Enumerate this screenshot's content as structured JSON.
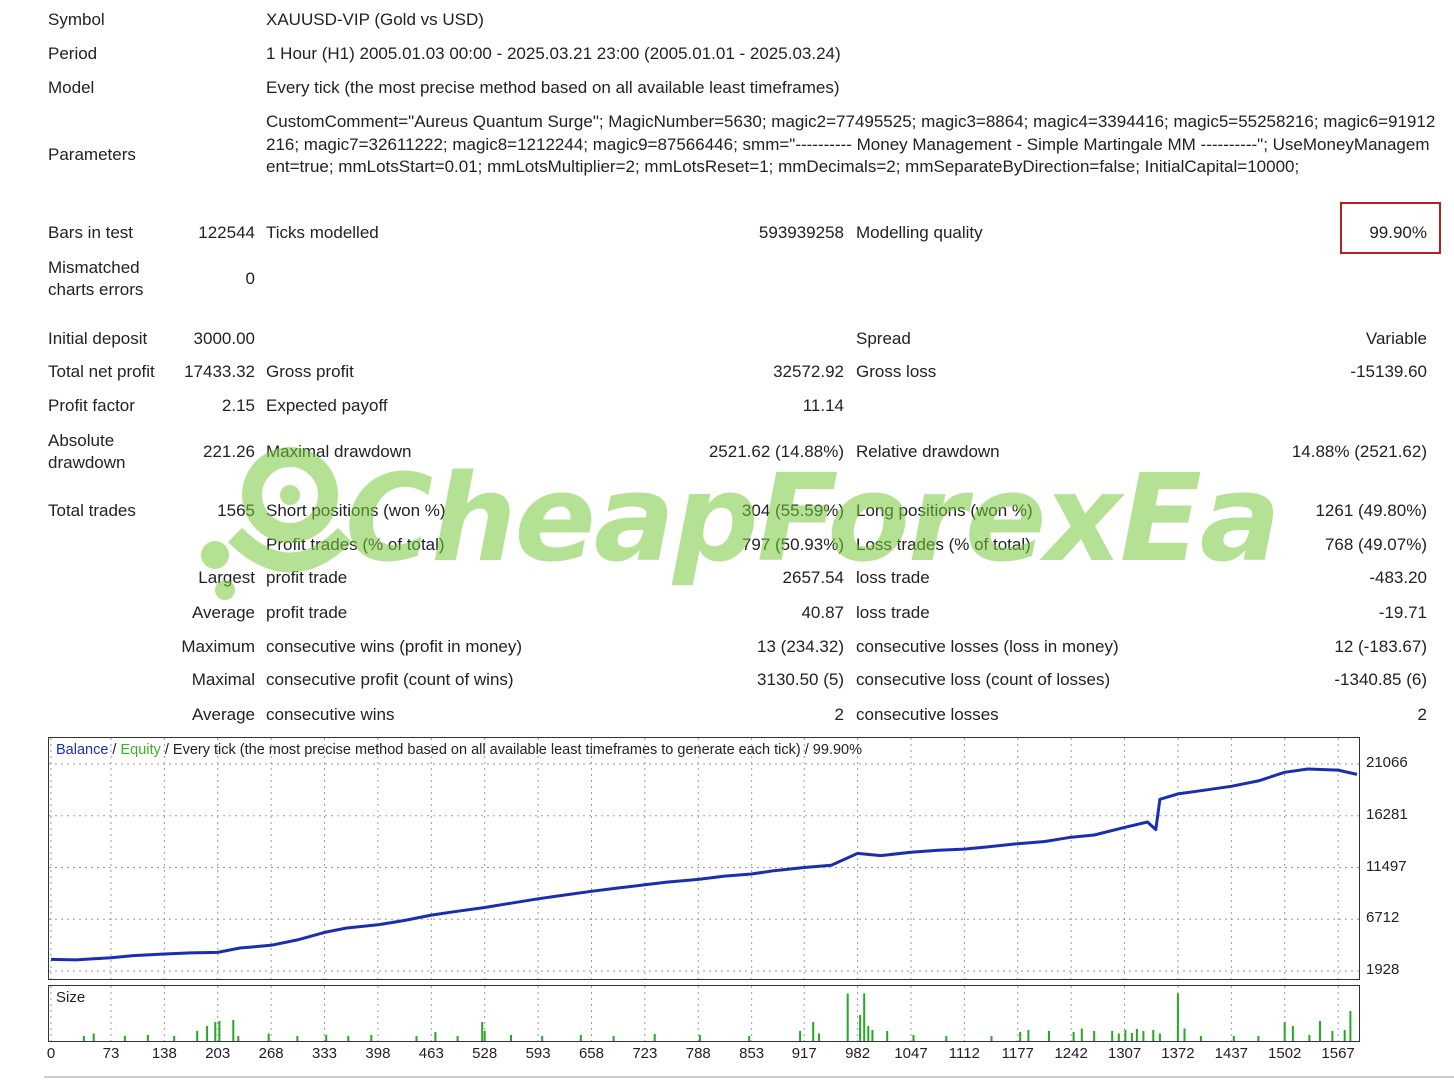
{
  "report": {
    "symbol_label": "Symbol",
    "symbol_value": "XAUUSD-VIP (Gold vs USD)",
    "period_label": "Period",
    "period_value": "1 Hour (H1) 2005.01.03 00:00 - 2025.03.21 23:00 (2005.01.01 - 2025.03.24)",
    "model_label": "Model",
    "model_value": "Every tick (the most precise method based on all available least timeframes)",
    "parameters_label": "Parameters",
    "parameters_value": "CustomComment=\"Aureus Quantum Surge\"; MagicNumber=5630; magic2=77495525; magic3=8864; magic4=3394416; magic5=55258216; magic6=91912216; magic7=32611222; magic8=1212244; magic9=87566446; smm=\"---------- Money Management - Simple Martingale MM ----------\"; UseMoneyManagement=true; mmLotsStart=0.01; mmLotsMultiplier=2; mmLotsReset=1; mmDecimals=2; mmSeparateByDirection=false; InitialCapital=10000;",
    "bars_label": "Bars in test",
    "bars_value": "122544",
    "ticks_label": "Ticks modelled",
    "ticks_value": "593939258",
    "quality_label": "Modelling quality",
    "quality_value": "99.90%",
    "mismatched_label_1": "Mismatched",
    "mismatched_label_2": "charts errors",
    "mismatched_value": "0",
    "initial_deposit_label": "Initial deposit",
    "initial_deposit_value": "3000.00",
    "spread_label": "Spread",
    "spread_value": "Variable",
    "net_profit_label": "Total net profit",
    "net_profit_value": "17433.32",
    "gross_profit_label": "Gross profit",
    "gross_profit_value": "32572.92",
    "gross_loss_label": "Gross loss",
    "gross_loss_value": "-15139.60",
    "profit_factor_label": "Profit factor",
    "profit_factor_value": "2.15",
    "expected_payoff_label": "Expected payoff",
    "expected_payoff_value": "11.14",
    "abs_drawdown_label_1": "Absolute",
    "abs_drawdown_label_2": "drawdown",
    "abs_drawdown_value": "221.26",
    "max_drawdown_label": "Maximal drawdown",
    "max_drawdown_value": "2521.62 (14.88%)",
    "rel_drawdown_label": "Relative drawdown",
    "rel_drawdown_value": "14.88% (2521.62)",
    "total_trades_label": "Total trades",
    "total_trades_value": "1565",
    "short_label": "Short positions (won %)",
    "short_value": "304 (55.59%)",
    "long_label": "Long positions (won %)",
    "long_value": "1261 (49.80%)",
    "profit_trades_label": "Profit trades (% of total)",
    "profit_trades_value": "797 (50.93%)",
    "loss_trades_label": "Loss trades (% of total)",
    "loss_trades_value": "768 (49.07%)",
    "largest_label": "Largest",
    "largest_profit_label": "profit trade",
    "largest_profit_value": "2657.54",
    "largest_loss_label": "loss trade",
    "largest_loss_value": "-483.20",
    "average_label": "Average",
    "average_profit_label": "profit trade",
    "average_profit_value": "40.87",
    "average_loss_label": "loss trade",
    "average_loss_value": "-19.71",
    "maximum_label": "Maximum",
    "max_cons_wins_label": "consecutive wins (profit in money)",
    "max_cons_wins_value": "13 (234.32)",
    "max_cons_losses_label": "consecutive losses (loss in money)",
    "max_cons_losses_value": "12 (-183.67)",
    "maximal_label": "Maximal",
    "maximal_cons_profit_label": "consecutive profit (count of wins)",
    "maximal_cons_profit_value": "3130.50 (5)",
    "maximal_cons_loss_label": "consecutive loss (count of losses)",
    "maximal_cons_loss_value": "-1340.85 (6)",
    "average2_label": "Average",
    "avg_cons_wins_label": "consecutive wins",
    "avg_cons_wins_value": "2",
    "avg_cons_losses_label": "consecutive losses",
    "avg_cons_losses_value": "2"
  },
  "watermark": {
    "text": "CheapForexEa"
  },
  "chart": {
    "legend_balance": "Balance",
    "legend_sep1": " / ",
    "legend_equity": "Equity",
    "legend_rest": " / Every tick (the most precise method based on all available least timeframes to generate each tick) / 99.90%",
    "size_label": "Size",
    "colors": {
      "balance": "#1a2fb0",
      "equity": "#3fae2a",
      "volume": "#22aa22",
      "grid": "#9a9a9a"
    }
  },
  "chart_data": {
    "type": "line",
    "title": "",
    "series": [
      {
        "name": "Balance",
        "x": [
          0,
          30,
          73,
          100,
          138,
          170,
          203,
          230,
          268,
          300,
          333,
          360,
          398,
          430,
          463,
          490,
          528,
          560,
          593,
          620,
          658,
          690,
          723,
          750,
          788,
          820,
          853,
          880,
          917,
          950,
          982,
          1010,
          1047,
          1080,
          1112,
          1140,
          1177,
          1210,
          1242,
          1270,
          1307,
          1335,
          1345,
          1350,
          1372,
          1400,
          1437,
          1470,
          1502,
          1530,
          1567,
          1590
        ],
        "y": [
          3000,
          2950,
          3150,
          3350,
          3500,
          3600,
          3650,
          4050,
          4300,
          4800,
          5500,
          5900,
          6200,
          6600,
          7100,
          7400,
          7800,
          8200,
          8600,
          8900,
          9300,
          9600,
          9900,
          10150,
          10400,
          10700,
          10900,
          11200,
          11500,
          11700,
          12800,
          12600,
          12900,
          13100,
          13200,
          13400,
          13700,
          13900,
          14300,
          14500,
          15200,
          15700,
          15000,
          17800,
          18300,
          18600,
          19000,
          19500,
          20300,
          20600,
          20500,
          20100
        ]
      }
    ],
    "y_ticks": [
      "21066",
      "16281",
      "11497",
      "6712",
      "1928"
    ],
    "ylim": [
      1928,
      21066
    ],
    "x_ticks": [
      "0",
      "73",
      "138",
      "203",
      "268",
      "333",
      "398",
      "463",
      "528",
      "593",
      "658",
      "723",
      "788",
      "853",
      "917",
      "982",
      "1047",
      "1112",
      "1177",
      "1242",
      "1307",
      "1372",
      "1437",
      "1502",
      "1567"
    ],
    "xlim": [
      0,
      1590
    ],
    "grid": true,
    "volume": {
      "x": [
        40,
        52,
        90,
        118,
        150,
        178,
        190,
        200,
        205,
        222,
        228,
        265,
        300,
        335,
        362,
        390,
        445,
        468,
        495,
        525,
        528,
        560,
        598,
        645,
        685,
        735,
        790,
        850,
        912,
        928,
        935,
        970,
        985,
        990,
        995,
        1000,
        1018,
        1050,
        1090,
        1145,
        1180,
        1190,
        1215,
        1245,
        1255,
        1270,
        1292,
        1300,
        1308,
        1316,
        1322,
        1330,
        1342,
        1350,
        1372,
        1380,
        1400,
        1440,
        1470,
        1502,
        1512,
        1532,
        1545,
        1560,
        1575,
        1582
      ],
      "y": [
        0.1,
        0.15,
        0.1,
        0.12,
        0.1,
        0.2,
        0.3,
        0.38,
        0.4,
        0.42,
        0.1,
        0.15,
        0.1,
        0.12,
        0.1,
        0.12,
        0.1,
        0.18,
        0.1,
        0.38,
        0.2,
        0.12,
        0.1,
        0.12,
        0.1,
        0.14,
        0.12,
        0.1,
        0.2,
        0.38,
        0.15,
        0.95,
        0.52,
        0.95,
        0.3,
        0.22,
        0.2,
        0.12,
        0.1,
        0.1,
        0.18,
        0.22,
        0.2,
        0.18,
        0.25,
        0.2,
        0.2,
        0.15,
        0.22,
        0.16,
        0.24,
        0.2,
        0.22,
        0.15,
        0.95,
        0.25,
        0.1,
        0.1,
        0.1,
        0.38,
        0.3,
        0.12,
        0.4,
        0.2,
        0.22,
        0.6
      ]
    }
  }
}
